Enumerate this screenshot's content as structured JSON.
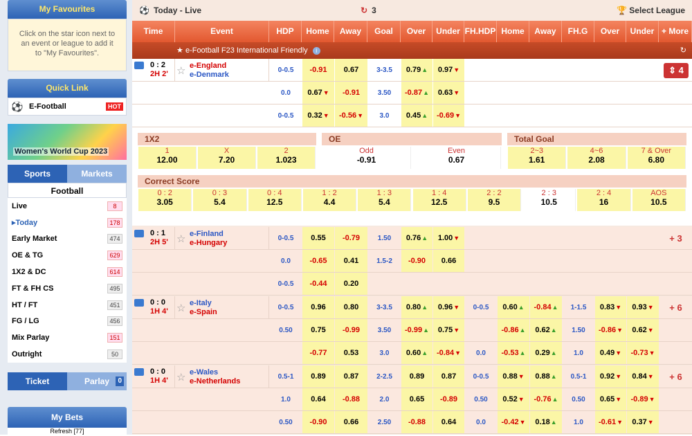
{
  "sidebar": {
    "favourites": {
      "title": "My Favourites",
      "hint": "Click on the star icon next to an event or league to add it to \"My Favourites\"."
    },
    "quick_link": {
      "title": "Quick Link",
      "item": "E-Football",
      "badge": "HOT"
    },
    "banner": "Women's World Cup 2023",
    "tabs": [
      "Sports",
      "Markets"
    ],
    "sport": "Football",
    "markets": [
      {
        "label": "Live",
        "count": "8"
      },
      {
        "label": "Today",
        "count": "178"
      },
      {
        "label": "Early Market",
        "count": "474"
      },
      {
        "label": "OE & TG",
        "count": "629"
      },
      {
        "label": "1X2 & DC",
        "count": "614"
      },
      {
        "label": "FT & FH CS",
        "count": "495"
      },
      {
        "label": "HT / FT",
        "count": "451"
      },
      {
        "label": "FG / LG",
        "count": "456"
      },
      {
        "label": "Mix Parlay",
        "count": "151"
      },
      {
        "label": "Outright",
        "count": "50"
      }
    ],
    "bet_tabs": [
      "Ticket",
      "Parlay"
    ],
    "parlay_count": "0",
    "my_bets": "My Bets",
    "refresh": "Refresh [77]"
  },
  "top": {
    "title": "Today - Live",
    "refresh_count": "3",
    "select_league": "Select League"
  },
  "columns": [
    "Time",
    "Event",
    "HDP",
    "Home",
    "Away",
    "Goal",
    "Over",
    "Under",
    "FH.HDP",
    "Home",
    "Away",
    "FH.G",
    "Over",
    "Under",
    "+ More"
  ],
  "league": "e-Football F23 International Friendly",
  "match1": {
    "score": "0 : 2",
    "time": "2H 2'",
    "home": "e-England",
    "away": "e-Denmark",
    "more": "4",
    "rows": [
      {
        "hdp": "0-0.5",
        "home": "-0.91",
        "away": "0.67",
        "goal": "3-3.5",
        "over": "0.79",
        "under": "0.97"
      },
      {
        "hdp": "0.0",
        "home": "0.67",
        "away": "-0.91",
        "goal": "3.50",
        "over": "-0.87",
        "under": "0.63"
      },
      {
        "hdp": "0-0.5",
        "home": "0.32",
        "away": "-0.56",
        "goal": "3.0",
        "over": "0.45",
        "under": "-0.69"
      }
    ],
    "x12": {
      "title": "1X2",
      "labels": [
        "1",
        "X",
        "2"
      ],
      "values": [
        "12.00",
        "7.20",
        "1.023"
      ]
    },
    "oe": {
      "title": "OE",
      "labels": [
        "Odd",
        "Even"
      ],
      "values": [
        "-0.91",
        "0.67"
      ]
    },
    "tg": {
      "title": "Total Goal",
      "labels": [
        "2~3",
        "4~6",
        "7 & Over"
      ],
      "values": [
        "1.61",
        "2.08",
        "6.80"
      ]
    },
    "cs": {
      "title": "Correct Score",
      "labels": [
        "0 : 2",
        "0 : 3",
        "0 : 4",
        "1 : 2",
        "1 : 3",
        "1 : 4",
        "2 : 2",
        "2 : 3",
        "2 : 4",
        "AOS"
      ],
      "values": [
        "3.05",
        "5.4",
        "12.5",
        "4.4",
        "5.4",
        "12.5",
        "9.5",
        "10.5",
        "16",
        "10.5"
      ]
    }
  },
  "match2": {
    "score": "0 : 1",
    "time": "2H 5'",
    "home": "e-Finland",
    "away": "e-Hungary",
    "more": "+ 3",
    "rows": [
      {
        "hdp": "0-0.5",
        "home": "0.55",
        "away": "-0.79",
        "goal": "1.50",
        "over": "0.76",
        "under": "1.00"
      },
      {
        "hdp": "0.0",
        "home": "-0.65",
        "away": "0.41",
        "goal": "1.5-2",
        "over": "-0.90",
        "under": "0.66"
      },
      {
        "hdp": "0-0.5",
        "home": "-0.44",
        "away": "0.20",
        "goal": "",
        "over": "",
        "under": ""
      }
    ]
  },
  "match3": {
    "score": "0 : 0",
    "time": "1H 4'",
    "home": "e-Italy",
    "away": "e-Spain",
    "more": "+ 6",
    "rows": [
      {
        "hdp": "0-0.5",
        "home": "0.96",
        "away": "0.80",
        "goal": "3-3.5",
        "over": "0.80",
        "under": "0.96",
        "fhhdp": "0-0.5",
        "fhhome": "0.60",
        "fhaway": "-0.84",
        "fhg": "1-1.5",
        "fhover": "0.83",
        "fhunder": "0.93"
      },
      {
        "hdp": "0.50",
        "home": "0.75",
        "away": "-0.99",
        "goal": "3.50",
        "over": "-0.99",
        "under": "0.75",
        "fhhdp": "",
        "fhhome": "-0.86",
        "fhaway": "0.62",
        "fhg": "1.50",
        "fhover": "-0.86",
        "fhunder": "0.62"
      },
      {
        "hdp": "",
        "home": "-0.77",
        "away": "0.53",
        "goal": "3.0",
        "over": "0.60",
        "under": "-0.84",
        "fhhdp": "0.0",
        "fhhome": "-0.53",
        "fhaway": "0.29",
        "fhg": "1.0",
        "fhover": "0.49",
        "fhunder": "-0.73"
      }
    ]
  },
  "match4": {
    "score": "0 : 0",
    "time": "1H 4'",
    "home": "e-Wales",
    "away": "e-Netherlands",
    "more": "+ 6",
    "rows": [
      {
        "hdp": "0.5-1",
        "home": "0.89",
        "away": "0.87",
        "goal": "2-2.5",
        "over": "0.89",
        "under": "0.87",
        "fhhdp": "0-0.5",
        "fhhome": "0.88",
        "fhaway": "0.88",
        "fhg": "0.5-1",
        "fhover": "0.92",
        "fhunder": "0.84"
      },
      {
        "hdp": "1.0",
        "home": "0.64",
        "away": "-0.88",
        "goal": "2.0",
        "over": "0.65",
        "under": "-0.89",
        "fhhdp": "0.50",
        "fhhome": "0.52",
        "fhaway": "-0.76",
        "fhg": "0.50",
        "fhover": "0.65",
        "fhunder": "-0.89"
      },
      {
        "hdp": "0.50",
        "home": "-0.90",
        "away": "0.66",
        "goal": "2.50",
        "over": "-0.88",
        "under": "0.64",
        "fhhdp": "0.0",
        "fhhome": "-0.42",
        "fhaway": "0.18",
        "fhg": "1.0",
        "fhover": "-0.61",
        "fhunder": "0.37"
      }
    ]
  }
}
